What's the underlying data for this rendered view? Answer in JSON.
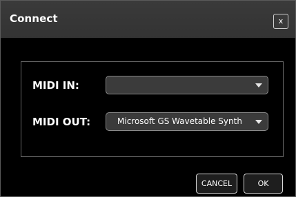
{
  "dialog": {
    "title": "Connect",
    "close_label": "x"
  },
  "midi_in": {
    "label": "MIDI IN:",
    "selected_value": ""
  },
  "midi_out": {
    "label": "MIDI OUT:",
    "selected_value": "Microsoft GS Wavetable Synth"
  },
  "buttons": {
    "cancel_label": "CANCEL",
    "ok_label": "OK"
  },
  "colors": {
    "background": "#000000",
    "titlebar": "#363636",
    "select_fill": "#3b3b3b",
    "border": "#6a6a6a"
  }
}
